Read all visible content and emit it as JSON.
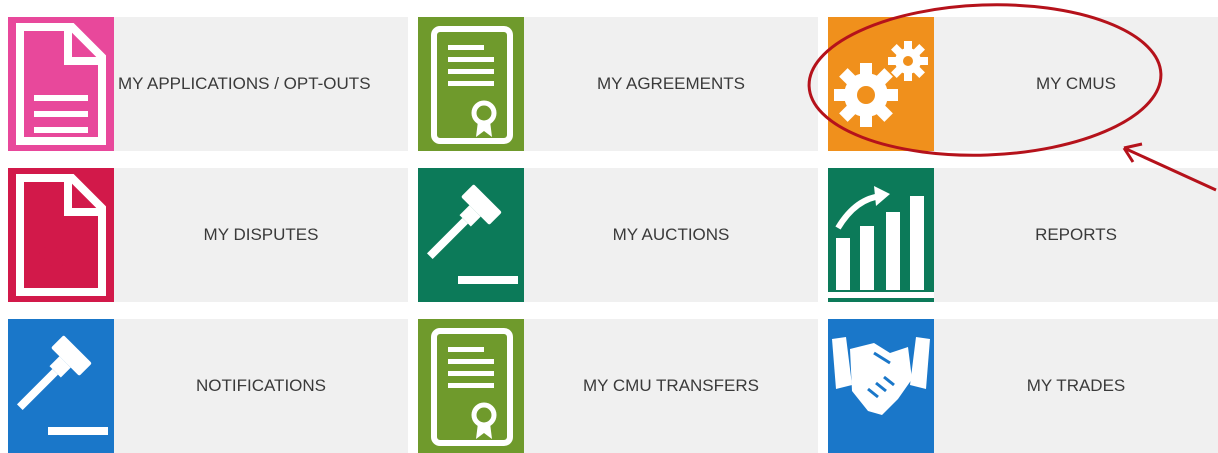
{
  "tiles": [
    {
      "label": "MY APPLICATIONS / OPT-OUTS",
      "icon": "document-lines-icon",
      "color": "#e8489b"
    },
    {
      "label": "MY AGREEMENTS",
      "icon": "certificate-icon",
      "color": "#6f9a2c"
    },
    {
      "label": "MY CMUS",
      "icon": "gears-icon",
      "color": "#f0901c"
    },
    {
      "label": "MY DISPUTES",
      "icon": "document-x-icon",
      "color": "#d2194a"
    },
    {
      "label": "MY AUCTIONS",
      "icon": "gavel-icon",
      "color": "#0c7a59"
    },
    {
      "label": "REPORTS",
      "icon": "bar-chart-icon",
      "color": "#0c7a59"
    },
    {
      "label": "NOTIFICATIONS",
      "icon": "gavel-icon",
      "color": "#1a77c9"
    },
    {
      "label": "MY CMU TRANSFERS",
      "icon": "certificate-icon",
      "color": "#6f9a2c"
    },
    {
      "label": "MY TRADES",
      "icon": "handshake-icon",
      "color": "#1a77c9"
    }
  ],
  "annotation": {
    "color": "#b5121b"
  }
}
